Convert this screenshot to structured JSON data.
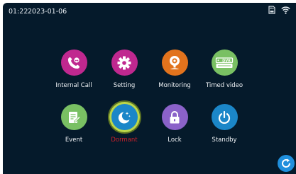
{
  "status": {
    "time": "01:22",
    "date": "2023-01-06",
    "icons": [
      "sd-card-icon",
      "wifi-icon"
    ]
  },
  "apps": [
    {
      "key": "internal-call",
      "label": "Internal Call",
      "icon": "phone-icon",
      "color": "#c0288f"
    },
    {
      "key": "setting",
      "label": "Setting",
      "icon": "gear-icon",
      "color": "#c0288f"
    },
    {
      "key": "monitoring",
      "label": "Monitoring",
      "icon": "webcam-icon",
      "color": "#e2731d"
    },
    {
      "key": "timed-video",
      "label": "Timed video",
      "icon": "dvr-icon",
      "color": "#79c063"
    },
    {
      "key": "event",
      "label": "Event",
      "icon": "notepad-icon",
      "color": "#79c063"
    },
    {
      "key": "dormant",
      "label": "Dormant",
      "icon": "moon-stars-icon",
      "color": "#1b86c8",
      "selected": true
    },
    {
      "key": "lock",
      "label": "Lock",
      "icon": "padlock-icon",
      "color": "#8b62c9"
    },
    {
      "key": "standby",
      "label": "Standby",
      "icon": "power-icon",
      "color": "#1b86c8"
    }
  ],
  "colors": {
    "background": "#051a2b",
    "selected_label": "#d2202a",
    "selection_ring": "#bbd64a",
    "refresh_button": "#1f8fdd"
  },
  "refresh_button": {
    "icon": "refresh-icon"
  }
}
